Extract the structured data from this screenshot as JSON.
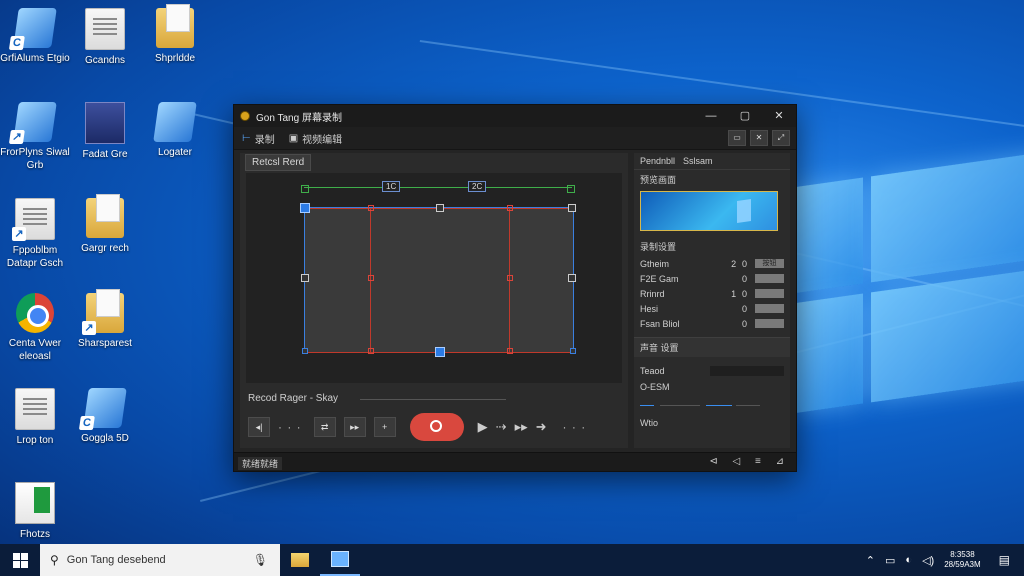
{
  "desktop": {
    "icons": [
      {
        "label": "GrfiAlums Etgio",
        "icon": "shortcut-app-icon"
      },
      {
        "label": "Gcandns",
        "icon": "text-file-icon"
      },
      {
        "label": "Shprldde",
        "icon": "folder-icon"
      },
      {
        "label": "FrorPlyns Siwal Grb",
        "icon": "shortcut-app-icon"
      },
      {
        "label": "Fadat Gre",
        "icon": "media-app-icon"
      },
      {
        "label": "Logater",
        "icon": "shortcut-app-icon"
      },
      {
        "label": "Fppoblbm Datapr Gsch",
        "icon": "text-file-icon"
      },
      {
        "label": "Gargr rech",
        "icon": "folder-icon"
      },
      {
        "label": "Centa Vwer eleoasl",
        "icon": "chrome-icon"
      },
      {
        "label": "Sharsparest",
        "icon": "folder-icon"
      },
      {
        "label": "Lrop ton",
        "icon": "text-file-icon"
      },
      {
        "label": "Goggla 5D",
        "icon": "shortcut-app-icon"
      },
      {
        "label": "Fhotzs",
        "icon": "spreadsheet-icon"
      }
    ]
  },
  "window": {
    "title": "Gon Tang 屏幕录制",
    "controls": {
      "minimize": "—",
      "maximize": "▢",
      "close": "✕"
    },
    "toolbar": {
      "tab1": {
        "icon": "record-area-icon",
        "glyph": "⊢",
        "label": "录制"
      },
      "tab2": {
        "icon": "edit-icon",
        "glyph": "▣",
        "label": "视频编辑"
      },
      "right_buttons": [
        {
          "icon": "screen-icon",
          "glyph": "▭"
        },
        {
          "icon": "settings-icon",
          "glyph": "✕"
        },
        {
          "icon": "share-icon",
          "glyph": "⤢"
        }
      ]
    },
    "left": {
      "area_label": "Retcsl Rerd",
      "ruler_tag_left": "1C",
      "ruler_tag_right": "2C",
      "range_label": "Recod Rager - Skay",
      "controls": {
        "dots": "· · ·",
        "record_color": "#d9483e"
      }
    },
    "right": {
      "tabs": [
        "Pendnbll",
        "Sslsam"
      ],
      "preview_label": "预览画面",
      "settings_label": "录制设置",
      "props": [
        {
          "name": "Gtheim",
          "value": "2",
          "v2": "0",
          "btn": "按钮"
        },
        {
          "name": "F2E Gam",
          "value": "",
          "v2": "0",
          "btn": ""
        },
        {
          "name": "Rrinrd",
          "value": "1",
          "v2": "0",
          "btn": ""
        },
        {
          "name": "Hesi",
          "value": "",
          "v2": "0",
          "btn": ""
        },
        {
          "name": "Fsan Bliol",
          "value": "",
          "v2": "0",
          "btn": ""
        }
      ],
      "section_label": "声音 设置",
      "s_rows": [
        {
          "name": "Teaod"
        },
        {
          "name": "O-ESM"
        }
      ],
      "mute_label": "Wtio"
    },
    "status": {
      "left": "就绪就绪",
      "right": "⊲ ◁ ≡ ⊿"
    }
  },
  "taskbar": {
    "search_text": "Gon Tang desebend",
    "tray": {
      "time": "8:3538",
      "date": "28/59A3M"
    },
    "accent": "#0b1d3a"
  }
}
